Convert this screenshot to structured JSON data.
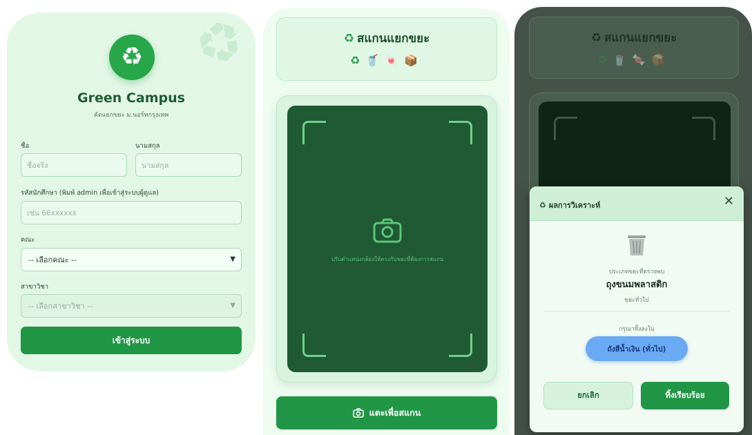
{
  "login": {
    "title": "Green Campus",
    "subtitle": "คัดแยกขยะ ม.นอร์ทกรุงเทพ",
    "first_name_label": "ชื่อ",
    "first_name_placeholder": "ชื่อจริง",
    "last_name_label": "นามสกุล",
    "last_name_placeholder": "นามสกุล",
    "student_id_label": "รหัสนักศึกษา (พิมพ์ admin เพื่อเข้าสู่ระบบผู้ดูแล)",
    "student_id_placeholder": "เช่น 66xxxxxx",
    "faculty_label": "คณะ",
    "faculty_selected": "-- เลือกคณะ --",
    "major_label": "สาขาวิชา",
    "major_selected": "-- เลือกสาขาวิชา --",
    "login_button": "เข้าสู่ระบบ",
    "logo_icon": "recycle-icon"
  },
  "scanner": {
    "title": "สแกนแยกขยะ",
    "waste_icons": [
      "recycle",
      "drink-cup",
      "candy",
      "box"
    ],
    "hint": "ปรับตำแหน่งกล้องให้ตรงกับขยะที่ต้องการสแกน",
    "scan_button": "แตะเพื่อสแกน"
  },
  "result": {
    "modal_title": "ผลการวิเคราะห์",
    "type_label": "ประเภทขยะที่ตรวจพบ",
    "item_name": "ถุงขนมพลาสติก",
    "category": "ขยะทั่วไป",
    "instruction": "กรุณาทิ้งลงใน",
    "bin_label": "ถังสีน้ำเงิน (ทั่วไป)",
    "cancel_button": "ยกเลิก",
    "done_button": "ทิ้งเรียบร้อย"
  },
  "colors": {
    "primary": "#219646",
    "blue_bin": "#6aa9f4",
    "background": "#e3f7e7"
  }
}
